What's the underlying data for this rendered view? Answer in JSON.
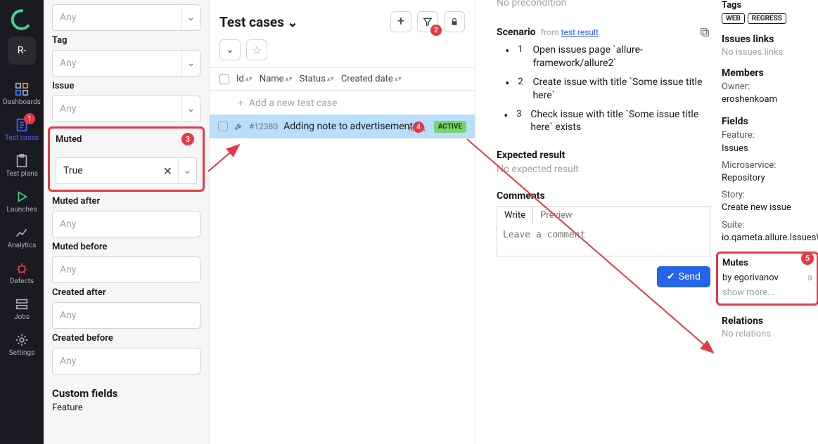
{
  "nav": {
    "workspace": "R-",
    "items": [
      {
        "label": "Dashboards"
      },
      {
        "label": "Test cases",
        "badge": "1"
      },
      {
        "label": "Test plans"
      },
      {
        "label": "Launches"
      },
      {
        "label": "Analytics"
      },
      {
        "label": "Defects"
      },
      {
        "label": "Jobs"
      },
      {
        "label": "Settings"
      }
    ]
  },
  "filters": {
    "any": "Any",
    "tag": "Tag",
    "issue": "Issue",
    "muted": "Muted",
    "muted_value": "True",
    "muted_after": "Muted after",
    "muted_before": "Muted before",
    "created_after": "Created after",
    "created_before": "Created before",
    "custom_fields": "Custom fields",
    "feature": "Feature"
  },
  "center": {
    "title": "Test cases",
    "add_test": "Add a new test case",
    "cols": {
      "id": "Id",
      "name": "Name",
      "status": "Status",
      "created": "Created date"
    },
    "row": {
      "id": "#12380",
      "name": "Adding note to advertisement",
      "status": "ACTIVE",
      "tests_label": "tests"
    }
  },
  "detail": {
    "no_precond": "No precondition",
    "scenario": "Scenario",
    "from": "from",
    "test_result": "test result",
    "steps": [
      "Open issues page `allure-framework/allure2`",
      "Create issue with title `Some issue title here`",
      "Check issue with title `Some issue title here` exists"
    ],
    "expected": "Expected result",
    "no_expected": "No expected result",
    "comments": "Comments",
    "write": "Write",
    "preview": "Preview",
    "leave_comment": "Leave a comment",
    "send": "Send"
  },
  "side": {
    "tags": "Tags",
    "tag_web": "WEB",
    "tag_regress": "REGRESS",
    "issues_links": "Issues links",
    "no_issues": "No issues links",
    "members": "Members",
    "owner_k": "Owner:",
    "owner_v": "eroshenkoam",
    "fields": "Fields",
    "feature_k": "Feature:",
    "feature_v": "Issues",
    "micro_k": "Microservice:",
    "micro_v": "Repository",
    "story_k": "Story:",
    "story_v": "Create new issue",
    "suite_k": "Suite:",
    "suite_v": "io.qameta.allure.IssuesWebTest",
    "mutes": "Mutes",
    "mutes_by": "by egorivanov",
    "mutes_when": "a",
    "show_more": "show more...",
    "relations": "Relations",
    "no_rel": "No relations"
  },
  "annot": {
    "n2": "2",
    "n3": "3",
    "n4": "4",
    "n5": "5"
  }
}
